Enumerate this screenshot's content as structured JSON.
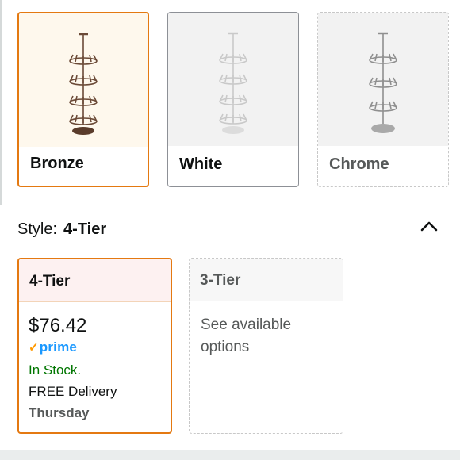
{
  "colors": {
    "items": [
      {
        "label": "Bronze",
        "state": "selected",
        "swatch": "#6b4a37"
      },
      {
        "label": "White",
        "state": "available",
        "swatch": "#e6e6e6"
      },
      {
        "label": "Chrome",
        "state": "unavailable",
        "swatch": "#9a9a9a"
      }
    ]
  },
  "style": {
    "label": "Style:",
    "selected": "4-Tier",
    "collapse_icon": "chevron-up-icon",
    "options": [
      {
        "label": "4-Tier",
        "price": "$76.42",
        "prime": "prime",
        "stock": "In Stock.",
        "delivery": "FREE Delivery",
        "delivery_day": "Thursday"
      },
      {
        "label": "3-Tier",
        "availability": "See available options"
      }
    ]
  },
  "theme": {
    "selected_border": "#e47911",
    "in_stock": "#007600",
    "prime_blue": "#1a98ff",
    "prime_check": "#ff9900"
  }
}
